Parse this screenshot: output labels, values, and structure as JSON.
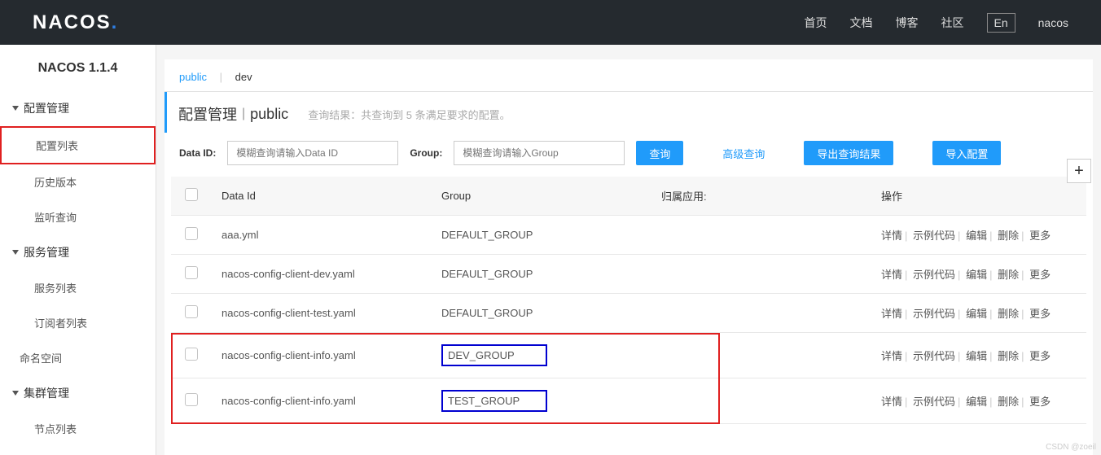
{
  "topnav": {
    "logo": "NACOS",
    "links": [
      "首页",
      "文档",
      "博客",
      "社区"
    ],
    "lang": "En",
    "user": "nacos"
  },
  "sidebar": {
    "title": "NACOS 1.1.4",
    "groups": [
      {
        "label": "配置管理",
        "items": [
          "配置列表",
          "历史版本",
          "监听查询"
        ],
        "active_index": 0
      },
      {
        "label": "服务管理",
        "items": [
          "服务列表",
          "订阅者列表"
        ]
      }
    ],
    "plain_items": [
      "命名空间"
    ],
    "groups2": [
      {
        "label": "集群管理",
        "items": [
          "节点列表"
        ]
      }
    ]
  },
  "tabs": {
    "active": "public",
    "other": "dev"
  },
  "titlebar": {
    "title": "配置管理",
    "sub": "public",
    "hint": "查询结果：共查询到 5 条满足要求的配置。"
  },
  "search": {
    "dataid_label": "Data ID:",
    "dataid_placeholder": "模糊查询请输入Data ID",
    "group_label": "Group:",
    "group_placeholder": "模糊查询请输入Group",
    "query_btn": "查询",
    "adv_link": "高级查询",
    "export_btn": "导出查询结果",
    "import_btn": "导入配置"
  },
  "table": {
    "headers": {
      "dataid": "Data Id",
      "group": "Group",
      "app": "归属应用:",
      "ops": "操作"
    },
    "rows": [
      {
        "dataid": "aaa.yml",
        "group": "DEFAULT_GROUP",
        "app": "",
        "highlight": false,
        "blue": false
      },
      {
        "dataid": "nacos-config-client-dev.yaml",
        "group": "DEFAULT_GROUP",
        "app": "",
        "highlight": false,
        "blue": false
      },
      {
        "dataid": "nacos-config-client-test.yaml",
        "group": "DEFAULT_GROUP",
        "app": "",
        "highlight": false,
        "blue": false
      },
      {
        "dataid": "nacos-config-client-info.yaml",
        "group": "DEV_GROUP",
        "app": "",
        "highlight": true,
        "blue": true
      },
      {
        "dataid": "nacos-config-client-info.yaml",
        "group": "TEST_GROUP",
        "app": "",
        "highlight": true,
        "blue": true
      }
    ],
    "actions": {
      "detail": "详情",
      "sample": "示例代码",
      "edit": "编辑",
      "delete": "删除",
      "more": "更多"
    }
  },
  "watermark": "CSDN @zoeil"
}
